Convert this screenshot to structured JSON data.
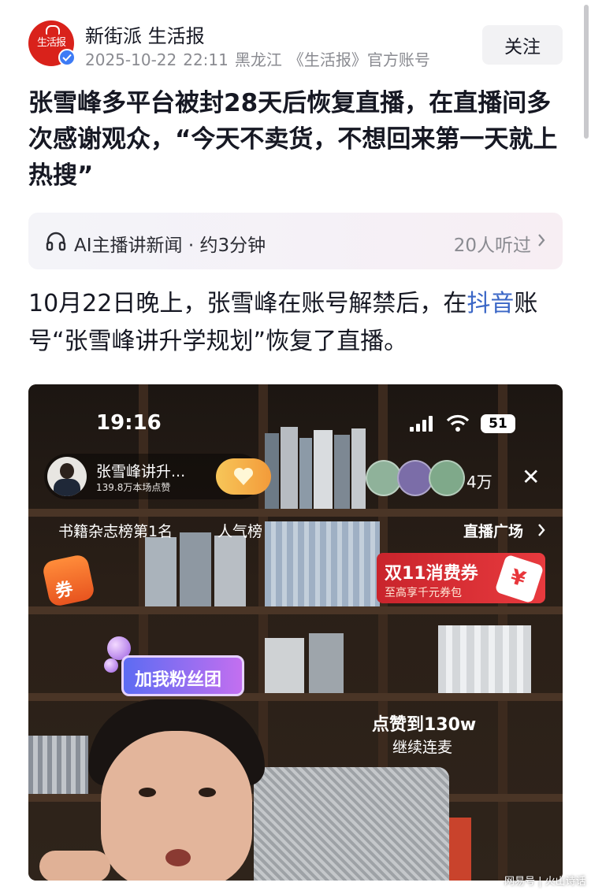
{
  "header": {
    "logo_text": "生活报",
    "author": "新街派 生活报",
    "date": "2025-10-22",
    "time": "22:11",
    "region": "黑龙江",
    "account_desc": "《生活报》官方账号",
    "follow_label": "关注"
  },
  "article": {
    "title": "张雪峰多平台被封28天后恢复直播，在直播间多次感谢观众，“今天不卖货，不想回来第一天就上热搜”",
    "audio": {
      "label": "AI主播讲新闻 · 约3分钟",
      "count": "20人听过"
    },
    "paragraph": {
      "before_link": "10月22日晚上，张雪峰在账号解禁后，在",
      "link": "抖音",
      "after_link": "账号“张雪峰讲升学规划”恢复了直播。"
    }
  },
  "live_image": {
    "status_time": "19:16",
    "battery": "51",
    "host_name": "张雪峰讲升...",
    "host_likes": "139.8万本场点赞",
    "viewer_count": "4万",
    "close": "✕",
    "rank": "书籍杂志榜第1名",
    "popularity": "人气榜",
    "plaza": "直播广场",
    "coupon_label": "券",
    "promo_title": "双11消费券",
    "promo_sub": "至高享千元券包",
    "promo_icon": "¥",
    "fan_badge": "加我粉丝团",
    "like_goal": "点赞到130w",
    "like_sub": "继续连麦"
  },
  "watermark": "网易号 | 火山诗话",
  "colors": {
    "brand_red": "#d9221b",
    "link_blue": "#3a66c6",
    "verify_blue": "#3d7bf5"
  },
  "icons": [
    "headphones-icon",
    "chevron-right-icon",
    "verified-icon",
    "signal-icon",
    "wifi-icon",
    "close-icon"
  ]
}
